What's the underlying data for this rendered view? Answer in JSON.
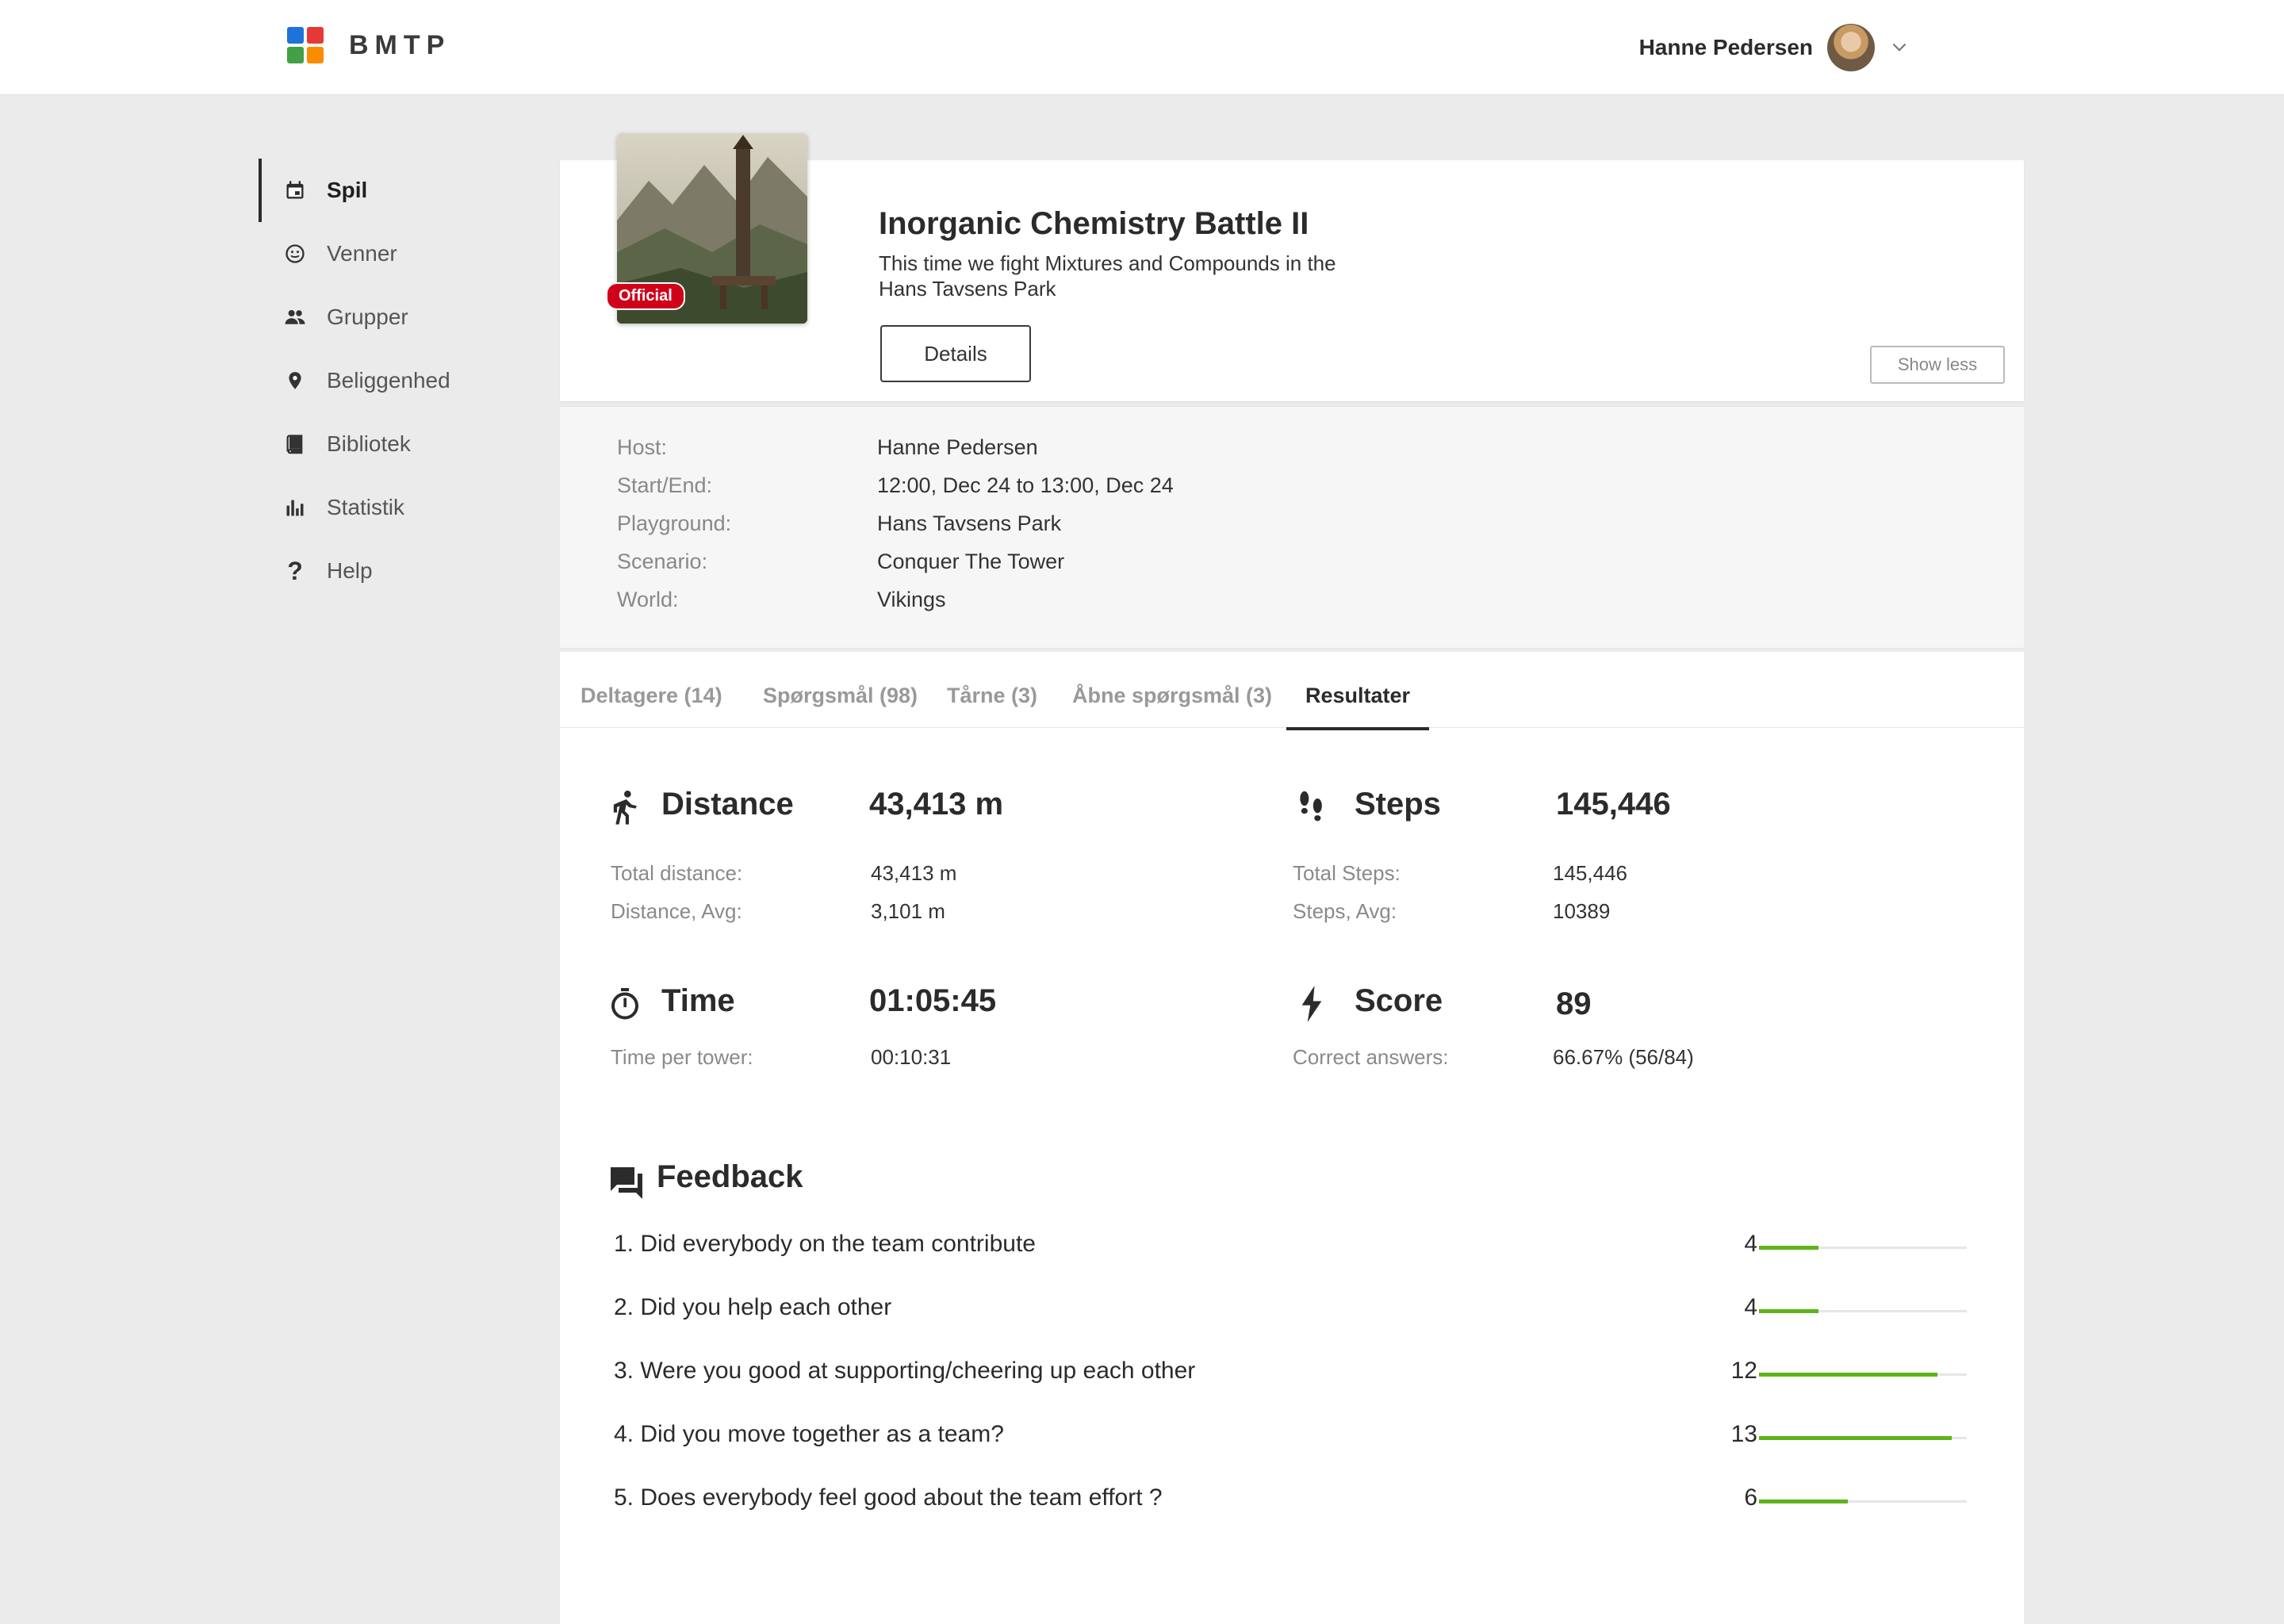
{
  "app": {
    "brand": "BMTP"
  },
  "user": {
    "name": "Hanne Pedersen"
  },
  "sidebar": {
    "items": [
      {
        "label": "Spil",
        "icon": "calendar-icon",
        "active": true
      },
      {
        "label": "Venner",
        "icon": "smiley-icon"
      },
      {
        "label": "Grupper",
        "icon": "group-icon"
      },
      {
        "label": "Beliggenhed",
        "icon": "location-pin-icon"
      },
      {
        "label": "Bibliotek",
        "icon": "book-icon"
      },
      {
        "label": "Statistik",
        "icon": "bar-chart-icon"
      },
      {
        "label": "Help",
        "icon": "question-icon"
      }
    ]
  },
  "game": {
    "badge": "Official",
    "title": "Inorganic Chemistry Battle II",
    "description": "This time we fight Mixtures and Compounds in the Hans Tavsens Park",
    "details_label": "Details",
    "show_less_label": "Show less"
  },
  "info": [
    {
      "label": "Host:",
      "value": "Hanne Pedersen"
    },
    {
      "label": "Start/End:",
      "value": "12:00, Dec 24 to 13:00, Dec 24"
    },
    {
      "label": "Playground:",
      "value": "Hans Tavsens Park"
    },
    {
      "label": "Scenario:",
      "value": "Conquer The Tower"
    },
    {
      "label": "World:",
      "value": "Vikings"
    }
  ],
  "tabs": [
    {
      "label": "Deltagere (14)"
    },
    {
      "label": "Spørgsmål (98)"
    },
    {
      "label": "Tårne (3)"
    },
    {
      "label": "Åbne spørgsmål (3)"
    },
    {
      "label": "Resultater",
      "active": true
    }
  ],
  "stats": {
    "distance": {
      "title": "Distance",
      "value": "43,413 m",
      "rows": [
        {
          "label": "Total distance:",
          "value": "43,413 m"
        },
        {
          "label": "Distance, Avg:",
          "value": "3,101 m"
        }
      ]
    },
    "steps": {
      "title": "Steps",
      "value": "145,446",
      "rows": [
        {
          "label": "Total Steps:",
          "value": "145,446"
        },
        {
          "label": "Steps, Avg:",
          "value": "10389"
        }
      ]
    },
    "time": {
      "title": "Time",
      "value": "01:05:45",
      "rows": [
        {
          "label": "Time per tower:",
          "value": "00:10:31"
        }
      ]
    },
    "score": {
      "title": "Score",
      "value": "89",
      "rows": [
        {
          "label": "Correct answers:",
          "value": "66.67% (56/84)"
        }
      ]
    }
  },
  "feedback": {
    "title": "Feedback",
    "accent": "#5fb31b",
    "max": 14,
    "items": [
      {
        "question": "1. Did everybody on the team contribute",
        "count": 4
      },
      {
        "question": "2. Did you help each other",
        "count": 4
      },
      {
        "question": "3. Were you good at supporting/cheering up each other",
        "count": 12
      },
      {
        "question": "4. Did you move together as a team?",
        "count": 13
      },
      {
        "question": "5. Does everybody feel good about the team effort ?",
        "count": 6
      }
    ]
  }
}
